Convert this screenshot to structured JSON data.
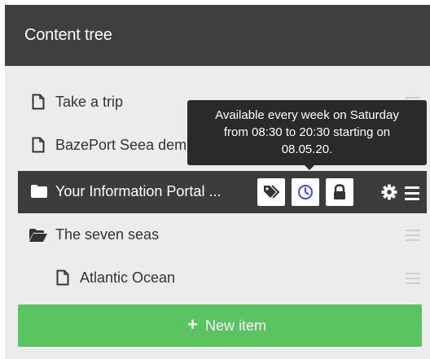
{
  "header": {
    "title": "Content tree"
  },
  "tree": {
    "items": [
      {
        "label": "Take a trip",
        "icon": "file-icon"
      },
      {
        "label": "BazePort Seea demo",
        "icon": "file-icon"
      },
      {
        "label": "Your Information Portal ...",
        "icon": "folder-icon"
      },
      {
        "label": "The seven seas",
        "icon": "folder-open-icon"
      },
      {
        "label": "Atlantic Ocean",
        "icon": "file-icon"
      }
    ]
  },
  "tooltip": {
    "lines": [
      "Available every week on Saturday",
      "from 08:30 to 20:30 starting on",
      "08.05.20."
    ]
  },
  "actions": {
    "new_item_label": "New item",
    "new_item_symbol": "+"
  },
  "colors": {
    "header_bg": "#3f3f3f",
    "selected_bg": "#3c3c3c",
    "schedule_icon": "#3b50e0",
    "new_button": "#5ac560"
  }
}
